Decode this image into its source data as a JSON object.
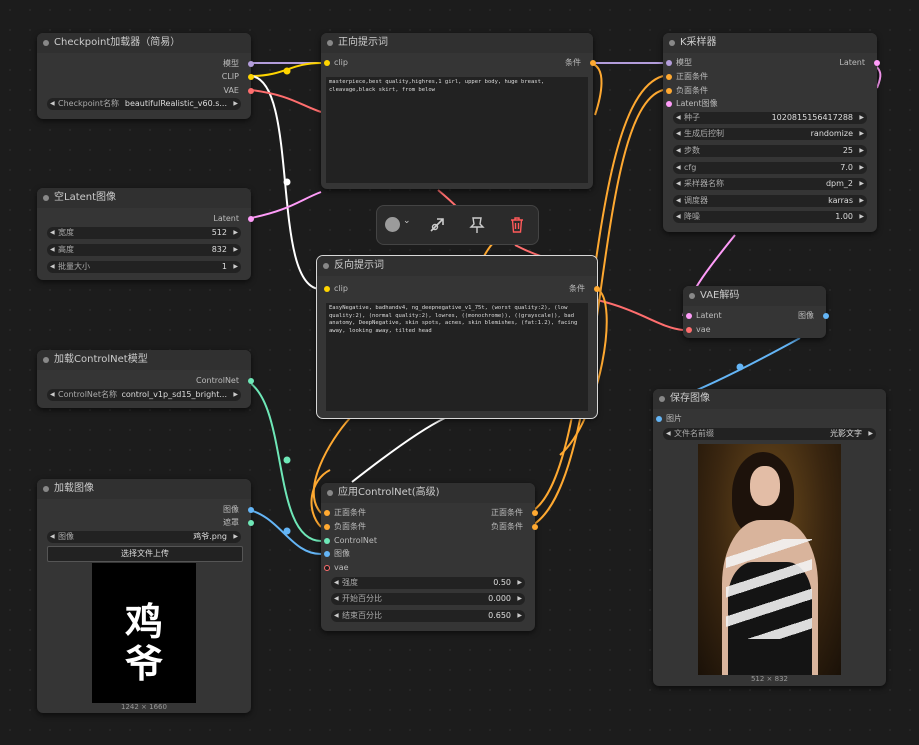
{
  "ckpt": {
    "title": "Checkpoint加载器（简易）",
    "outputs": [
      "模型",
      "CLIP",
      "VAE"
    ],
    "widget_label": "Checkpoint名称",
    "widget_value": "beautifulRealistic_v60.s..."
  },
  "latent": {
    "title": "空Latent图像",
    "output": "Latent",
    "widgets": [
      {
        "label": "宽度",
        "value": "512"
      },
      {
        "label": "高度",
        "value": "832"
      },
      {
        "label": "批量大小",
        "value": "1"
      }
    ]
  },
  "cnload": {
    "title": "加载ControlNet模型",
    "output": "ControlNet",
    "widget_label": "ControlNet名称",
    "widget_value": "control_v1p_sd15_bright..."
  },
  "loadimg": {
    "title": "加载图像",
    "outputs": [
      "图像",
      "遮罩"
    ],
    "widget_label": "图像",
    "widget_value": "鸡爷.png",
    "upload": "选择文件上传",
    "preview_text": "鸡\n爷",
    "size": "1242 × 1660"
  },
  "pos": {
    "title": "正向提示词",
    "input": "clip",
    "output": "条件",
    "text": "masterpiece,best quality,highres,1 girl, upper body, huge breast, cleavage,black skirt, from below"
  },
  "neg": {
    "title": "反向提示词",
    "input": "clip",
    "output": "条件",
    "text": "EasyNegative, badhandv4, ng_deepnegative_v1_75t, (worst quality:2), (low quality:2), (normal quality:2), lowres, ((monochrome)), ((grayscale)), bad anatomy, DeepNegative, skin spots, acnes, skin blemishes, (fat:1.2), facing away, looking away, tilted head"
  },
  "apply": {
    "title": "应用ControlNet(高级)",
    "inputs": [
      "正面条件",
      "负面条件",
      "ControlNet",
      "图像",
      "vae"
    ],
    "outputs": [
      "正面条件",
      "负面条件"
    ],
    "widgets": [
      {
        "label": "强度",
        "value": "0.50"
      },
      {
        "label": "开始百分比",
        "value": "0.000"
      },
      {
        "label": "结束百分比",
        "value": "0.650"
      }
    ]
  },
  "ksampler": {
    "title": "K采样器",
    "inputs": [
      "模型",
      "正面条件",
      "负面条件",
      "Latent图像"
    ],
    "output": "Latent",
    "widgets": [
      {
        "label": "种子",
        "value": "1020815156417288"
      },
      {
        "label": "生成后控制",
        "value": "randomize"
      },
      {
        "label": "步数",
        "value": "25"
      },
      {
        "label": "cfg",
        "value": "7.0"
      },
      {
        "label": "采样器名称",
        "value": "dpm_2"
      },
      {
        "label": "调度器",
        "value": "karras"
      },
      {
        "label": "降噪",
        "value": "1.00"
      }
    ]
  },
  "vae": {
    "title": "VAE解码",
    "inputs": [
      "Latent",
      "vae"
    ],
    "output": "图像"
  },
  "save": {
    "title": "保存图像",
    "input": "图片",
    "widget_label": "文件名前缀",
    "widget_value": "光影文字",
    "size": "512 × 832"
  },
  "toolbar": {
    "icons": [
      "color-icon",
      "bypass-icon",
      "pin-icon",
      "delete-icon"
    ]
  },
  "colors": {
    "model": "#b39ddb",
    "clip": "#ffd500",
    "vae": "#ff6e6e",
    "latent": "#ff9cf9",
    "cond": "#ffa931",
    "controlnet": "#6ee7b7",
    "image": "#64b5f6"
  }
}
